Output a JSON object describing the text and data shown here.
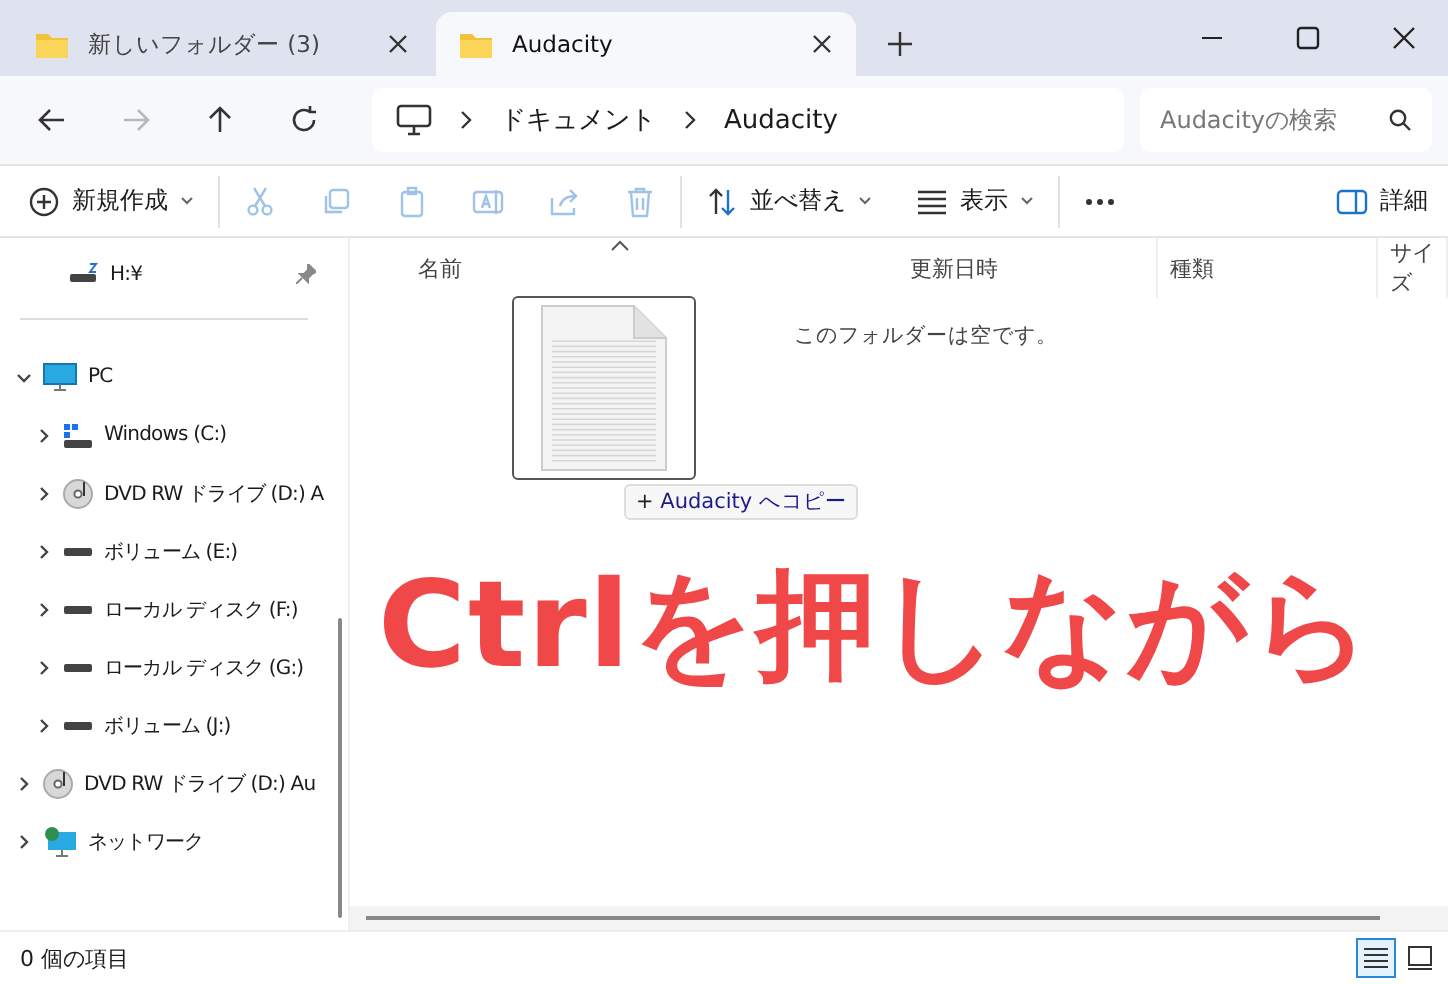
{
  "tabs": [
    {
      "title": "新しいフォルダー (3)",
      "selected": false
    },
    {
      "title": "Audacity",
      "selected": true
    }
  ],
  "nav_buttons": [
    {
      "kind": "back",
      "disabled": false
    },
    {
      "kind": "forward",
      "disabled": true
    },
    {
      "kind": "up",
      "disabled": false
    },
    {
      "kind": "refresh",
      "disabled": false
    }
  ],
  "breadcrumb": [
    "ドキュメント",
    "Audacity"
  ],
  "search": {
    "placeholder": "Audacityの検索"
  },
  "toolbar": [
    [
      {
        "kind": "new",
        "label": "新規作成",
        "dropdown": true,
        "disabled": false
      }
    ],
    [
      {
        "kind": "cut",
        "disabled": true
      },
      {
        "kind": "copy",
        "disabled": true
      },
      {
        "kind": "paste",
        "disabled": true
      },
      {
        "kind": "rename",
        "disabled": true
      },
      {
        "kind": "share",
        "disabled": true
      },
      {
        "kind": "delete",
        "disabled": true
      }
    ],
    [
      {
        "kind": "sort",
        "label": "並べ替え",
        "dropdown": true,
        "disabled": false
      },
      {
        "kind": "view",
        "label": "表示",
        "dropdown": true,
        "disabled": false
      }
    ],
    [
      {
        "kind": "more",
        "disabled": false
      }
    ]
  ],
  "details_button": {
    "label": "詳細"
  },
  "sidebar": {
    "quick_access": [
      {
        "label": "H:¥",
        "kind": "network-drive",
        "pinned": true
      }
    ],
    "tree": [
      {
        "label": "PC",
        "kind": "pc",
        "expanded": true,
        "children": [
          {
            "label": "Windows (C:)",
            "kind": "system-drive",
            "expanded": false
          },
          {
            "label": "DVD RW ドライブ (D:) A",
            "kind": "disc",
            "expanded": false
          },
          {
            "label": "ボリューム (E:)",
            "kind": "drive",
            "expanded": false
          },
          {
            "label": "ローカル ディスク (F:)",
            "kind": "drive",
            "expanded": false
          },
          {
            "label": "ローカル ディスク (G:)",
            "kind": "drive",
            "expanded": false
          },
          {
            "label": "ボリューム (J:)",
            "kind": "drive",
            "expanded": false
          }
        ]
      },
      {
        "label": "DVD RW ドライブ (D:) Au",
        "kind": "disc",
        "expanded": false
      },
      {
        "label": "ネットワーク",
        "kind": "network",
        "expanded": false
      }
    ]
  },
  "columns": [
    "名前",
    "更新日時",
    "種類",
    "サイズ"
  ],
  "empty_message": "このフォルダーは空です。",
  "drag_badge": {
    "symbol": "+",
    "label": "Audacity へコピー"
  },
  "caption": "Ctrlを押しながら",
  "status_bar": {
    "item_count": "0 個の項目",
    "view_buttons": [
      {
        "kind": "details",
        "selected": true
      },
      {
        "kind": "tiles",
        "selected": false
      }
    ]
  }
}
